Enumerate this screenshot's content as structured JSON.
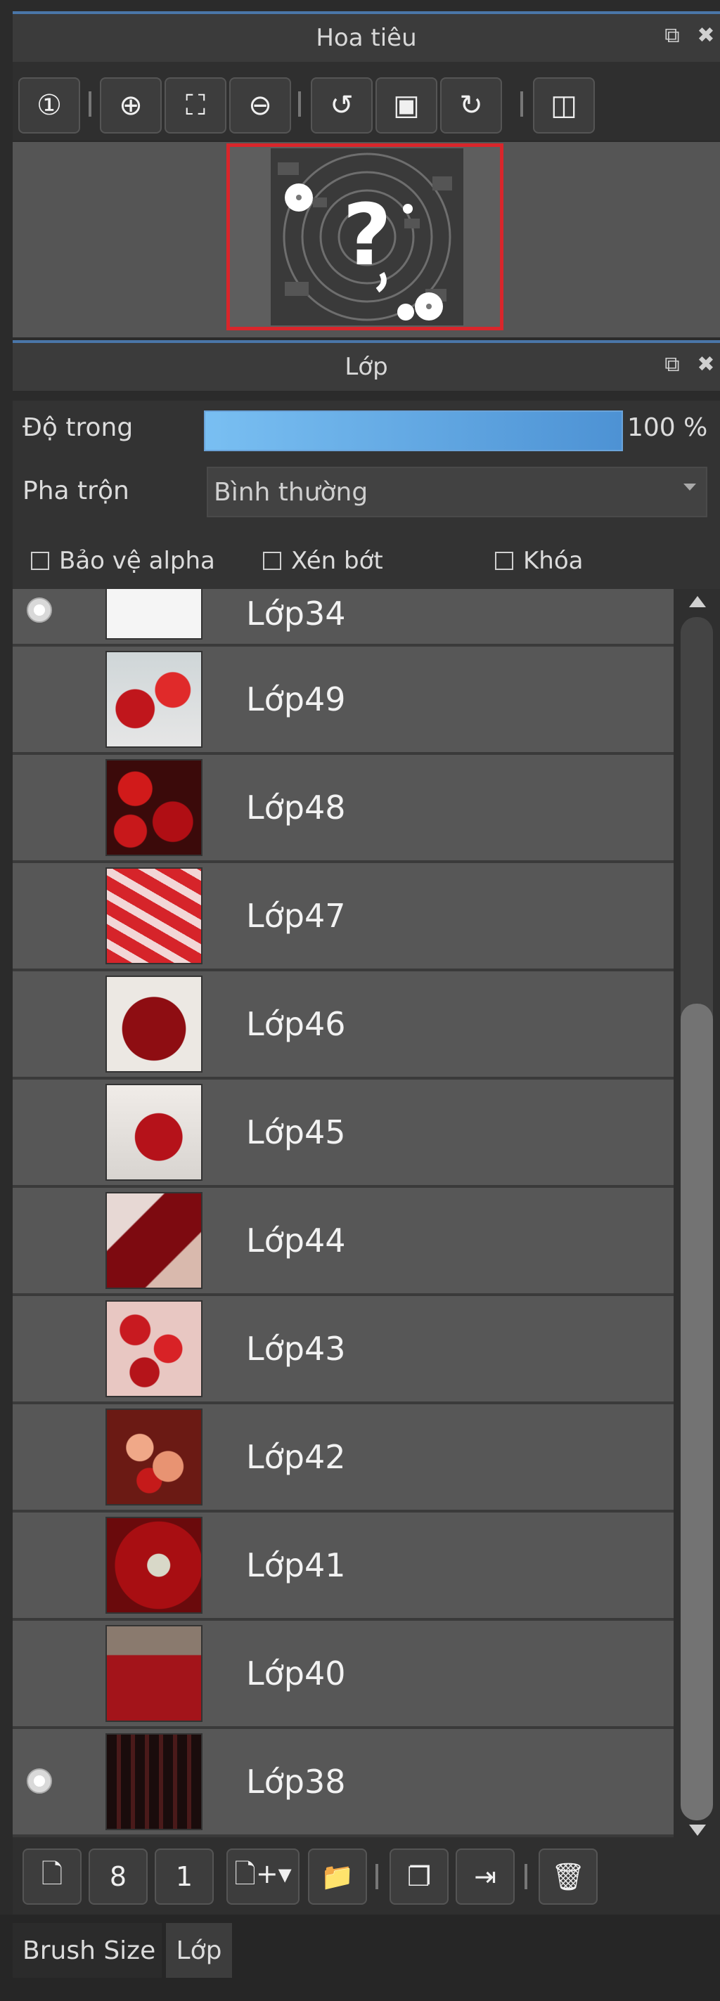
{
  "navigator": {
    "title": "Hoa tiêu",
    "toolbar": [
      {
        "name": "zoom-reset-button",
        "glyph": "①"
      },
      {
        "name": "zoom-in-button",
        "glyph": "⊕"
      },
      {
        "name": "fit-screen-button",
        "glyph": "⛶"
      },
      {
        "name": "zoom-out-button",
        "glyph": "⊖"
      },
      {
        "name": "rotate-left-button",
        "glyph": "↺"
      },
      {
        "name": "fit-canvas-button",
        "glyph": "▣"
      },
      {
        "name": "rotate-right-button",
        "glyph": "↻"
      },
      {
        "name": "flip-button",
        "glyph": "◫"
      }
    ]
  },
  "layers_panel": {
    "title": "Lớp",
    "opacity_label": "Độ trong",
    "opacity_value": "100 %",
    "blend_label": "Pha trộn",
    "blend_value": "Bình thường",
    "checkboxes": [
      "Bảo vệ alpha",
      "Xén bớt",
      "Khóa"
    ],
    "layers": [
      {
        "name": "Lớp34",
        "visible": true
      },
      {
        "name": "Lớp49",
        "visible": false
      },
      {
        "name": "Lớp48",
        "visible": false
      },
      {
        "name": "Lớp47",
        "visible": false
      },
      {
        "name": "Lớp46",
        "visible": false
      },
      {
        "name": "Lớp45",
        "visible": false
      },
      {
        "name": "Lớp44",
        "visible": false
      },
      {
        "name": "Lớp43",
        "visible": false
      },
      {
        "name": "Lớp42",
        "visible": false
      },
      {
        "name": "Lớp41",
        "visible": false
      },
      {
        "name": "Lớp40",
        "visible": false
      },
      {
        "name": "Lớp38",
        "visible": true
      }
    ]
  },
  "bottom_toolbar": [
    {
      "name": "new-layer-button",
      "glyph": "🗋"
    },
    {
      "name": "new-8bit-layer-button",
      "glyph": "8"
    },
    {
      "name": "new-1bit-layer-button",
      "glyph": "1"
    },
    {
      "name": "add-layer-menu-button",
      "glyph": "🗋+▾"
    },
    {
      "name": "new-folder-button",
      "glyph": "📁"
    },
    {
      "name": "duplicate-layer-button",
      "glyph": "❐"
    },
    {
      "name": "merge-layer-button",
      "glyph": "⇥"
    },
    {
      "name": "delete-layer-button",
      "glyph": "🗑"
    }
  ],
  "tabs": {
    "brush_size": "Brush Size",
    "layer": "Lớp"
  },
  "colors": {
    "accent_blue": "#4a76a8",
    "preview_border": "#d9262b",
    "row_bg": "#575757"
  }
}
